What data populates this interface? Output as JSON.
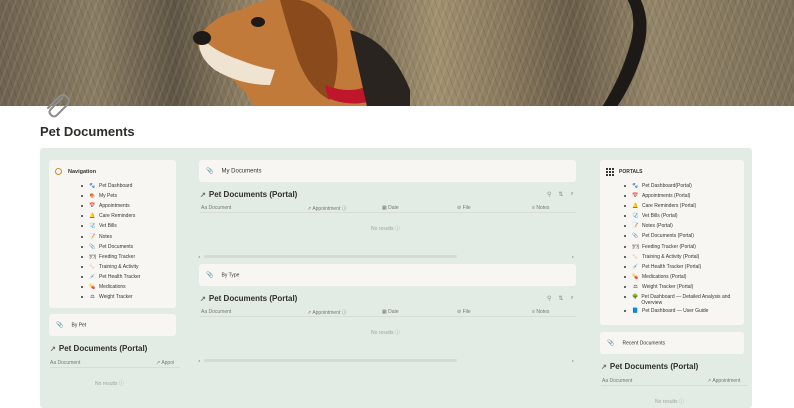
{
  "page": {
    "title": "Pet Documents",
    "icon": "paperclip-icon"
  },
  "cover": {
    "image": "beagle-in-grass"
  },
  "navigation": {
    "heading": "Navigation",
    "items": [
      {
        "icon": "🐾",
        "label": "Pet Dashboard"
      },
      {
        "icon": "🍖",
        "label": "My Pets"
      },
      {
        "icon": "📅",
        "label": "Appointments"
      },
      {
        "icon": "🔔",
        "label": "Care Reminders"
      },
      {
        "icon": "🩺",
        "label": "Vet Bills"
      },
      {
        "icon": "📝",
        "label": "Notes"
      },
      {
        "icon": "📎",
        "label": "Pet Documents"
      },
      {
        "icon": "🍽",
        "label": "Feeding Tracker"
      },
      {
        "icon": "🦴",
        "label": "Training & Activity"
      },
      {
        "icon": "💉",
        "label": "Pet Health Tracker"
      },
      {
        "icon": "💊",
        "label": "Medications"
      },
      {
        "icon": "⚖",
        "label": "Weight Tracker"
      }
    ]
  },
  "by_pet": {
    "label": "By Pet"
  },
  "my_documents": {
    "label": "My Documents"
  },
  "by_type": {
    "label": "By Type"
  },
  "recent_documents": {
    "label": "Recent Documents"
  },
  "db_title": "Pet Documents (Portal)",
  "columns": {
    "document": "Document",
    "appointment": "Appointment",
    "date": "Date",
    "file": "File",
    "notes": "Notes",
    "appt_short": "Appoi"
  },
  "no_results": "No results",
  "portals": {
    "heading": "PORTALS",
    "items": [
      {
        "icon": "🐾",
        "label": "Pet Dashboard(Portal)"
      },
      {
        "icon": "📅",
        "label": "Appointments (Portal)"
      },
      {
        "icon": "🔔",
        "label": "Care Reminders (Portal)"
      },
      {
        "icon": "🩺",
        "label": "Vet Bills (Portal)"
      },
      {
        "icon": "📝",
        "label": "Notes (Portal)"
      },
      {
        "icon": "📎",
        "label": "Pet Documents (Portal)"
      },
      {
        "icon": "🍽",
        "label": "Feeding Tracker (Portal)"
      },
      {
        "icon": "🦴",
        "label": "Training & Activity (Portal)"
      },
      {
        "icon": "💉",
        "label": "Pet Health Tracker (Portal)"
      },
      {
        "icon": "💊",
        "label": "Medications (Portal)"
      },
      {
        "icon": "⚖",
        "label": "Weight Tracker (Portal)"
      },
      {
        "icon": "🌳",
        "label": "Pet Dashboard — Detailed Analysis and Overview"
      },
      {
        "icon": "📘",
        "label": "Pet Dashboard — User Guide"
      }
    ]
  },
  "colors": {
    "panel": "#e3ece4",
    "card": "#f7f6f3",
    "accent": "#d08a1e"
  }
}
